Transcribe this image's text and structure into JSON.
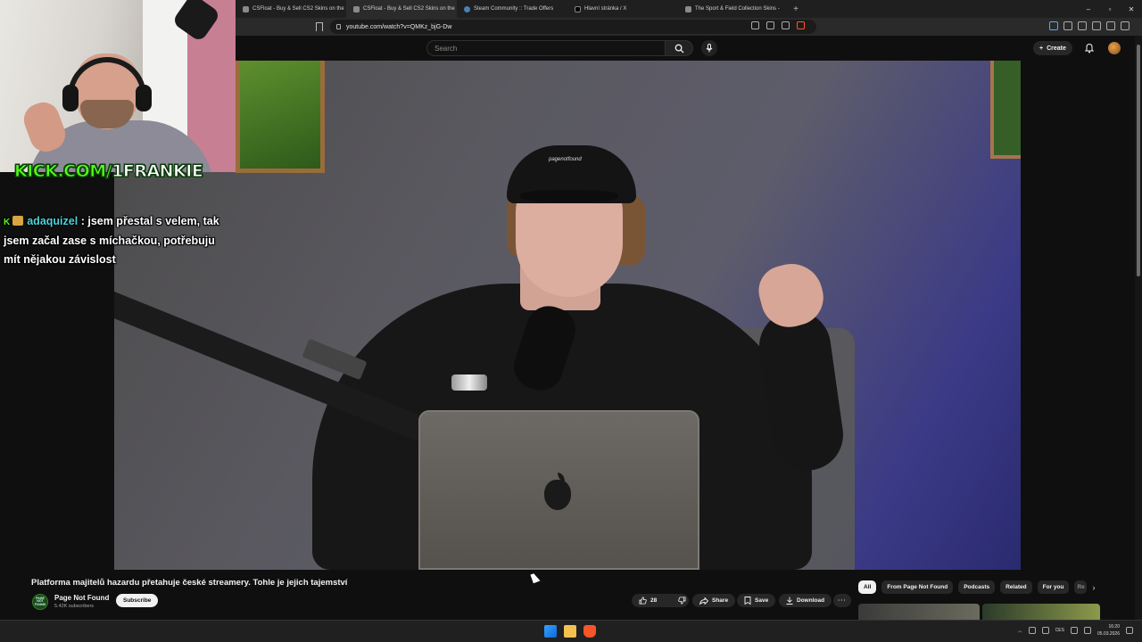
{
  "browser": {
    "tabs": [
      {
        "label": "CSFloat - Buy & Sell CS2 Skins on the"
      },
      {
        "label": "CSFloat - Buy & Sell CS2 Skins on the"
      },
      {
        "label": "Steam Community :: Trade Offers"
      },
      {
        "label": "Hlavní stránka / X"
      },
      {
        "label": "The Sport & Field Collection Skins -"
      }
    ],
    "new_tab": "+",
    "url": "youtube.com/watch?v=QMKz_bjG-Dw",
    "window_controls": [
      "–",
      "▫",
      "✕"
    ]
  },
  "youtube": {
    "search_placeholder": "Search",
    "create_label": "Create"
  },
  "webcam_overlay": {
    "kick_prefix": "KICK.COM/",
    "kick_handle": "1FRANKIE",
    "chat": {
      "badge": "K",
      "username": "adaquizel",
      "separator": ":",
      "message": "jsem přestal s velem, tak jsem začal zase s míchačkou, potřebuju mít nějakou závislost"
    }
  },
  "video": {
    "title": "Platforma majitelů hazardu přetahuje české streamery. Tohle je jejich tajemství",
    "cap_text": "pagenotfound",
    "channel_name": "Page Not Found",
    "channel_avatar_text": "PAGE NOT FOUND",
    "subscribers": "5.42K subscribers",
    "subscribe_label": "Subscribe",
    "like_count": "28",
    "share_label": "Share",
    "save_label": "Save",
    "download_label": "Download",
    "more_label": "···"
  },
  "chips": [
    {
      "label": "All",
      "active": true
    },
    {
      "label": "From Page Not Found"
    },
    {
      "label": "Podcasts"
    },
    {
      "label": "Related"
    },
    {
      "label": "For you"
    },
    {
      "label": "Re"
    }
  ],
  "taskbar": {
    "tray_lang": "CES",
    "time": "16:20",
    "date": "05.03.2026"
  },
  "colors": {
    "kick_green": "#53fc18",
    "chat_username": "#4fd1d9",
    "yt_bg": "#0f0f0f"
  }
}
